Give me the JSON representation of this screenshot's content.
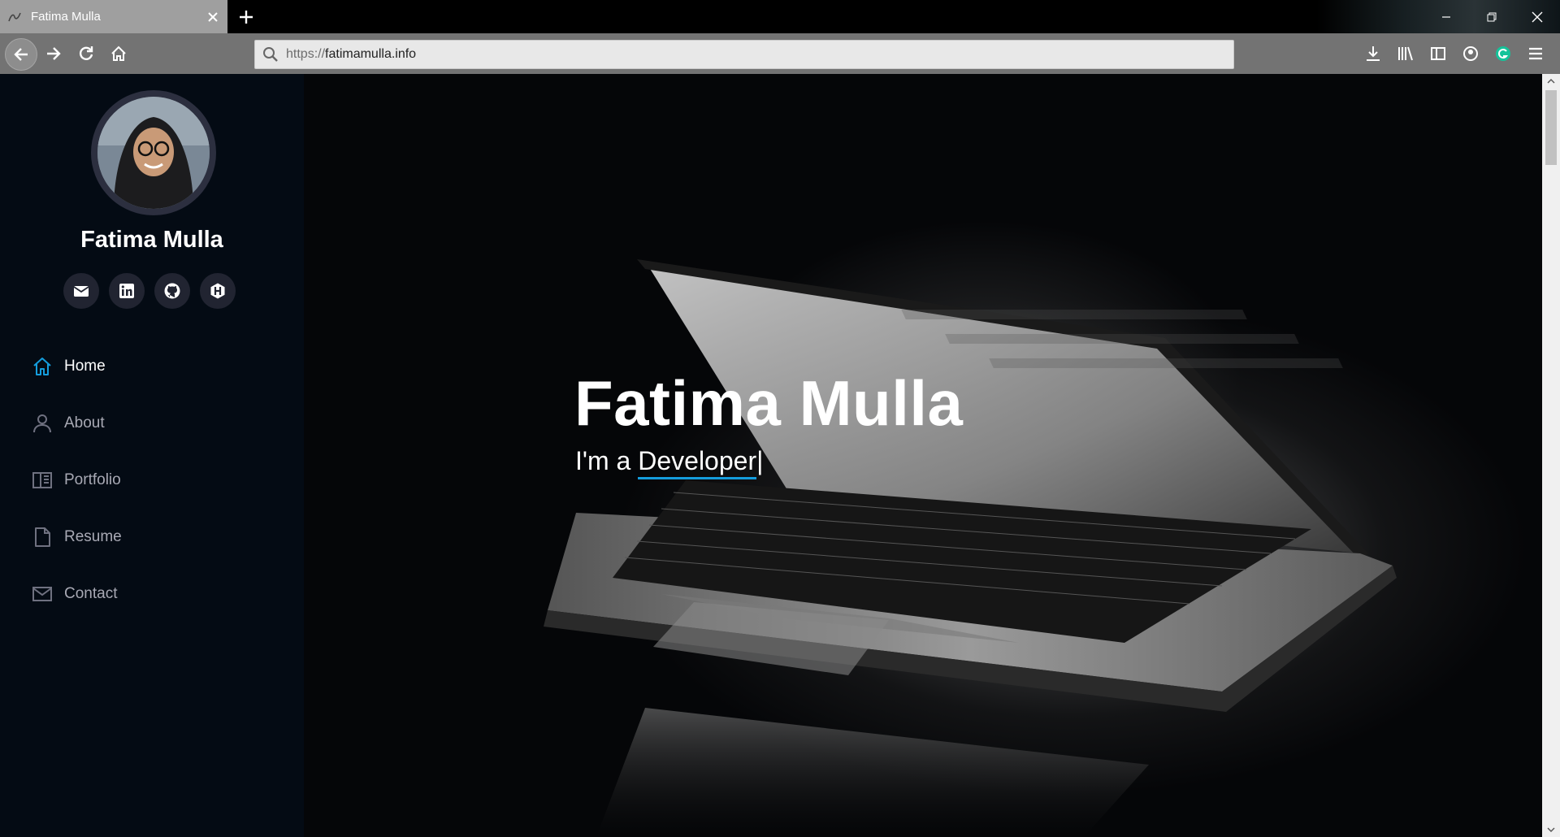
{
  "browser": {
    "tab_title": "Fatima Mulla",
    "url_protocol": "https://",
    "url_host": "fatimamulla.info"
  },
  "sidebar": {
    "name": "Fatima Mulla",
    "socials": [
      {
        "icon": "email-icon"
      },
      {
        "icon": "linkedin-icon"
      },
      {
        "icon": "github-icon"
      },
      {
        "icon": "hackerrank-icon"
      }
    ],
    "nav": [
      {
        "label": "Home",
        "icon": "home-icon",
        "active": true
      },
      {
        "label": "About",
        "icon": "person-icon"
      },
      {
        "label": "Portfolio",
        "icon": "book-icon"
      },
      {
        "label": "Resume",
        "icon": "file-icon"
      },
      {
        "label": "Contact",
        "icon": "envelope-icon"
      }
    ]
  },
  "hero": {
    "title": "Fatima Mulla",
    "sub_prefix": "I'm a ",
    "sub_typed": "Developer",
    "cursor": "|"
  },
  "colors": {
    "accent": "#149ddd",
    "sidebar_bg": "#040b14",
    "social_bg": "#212431"
  }
}
